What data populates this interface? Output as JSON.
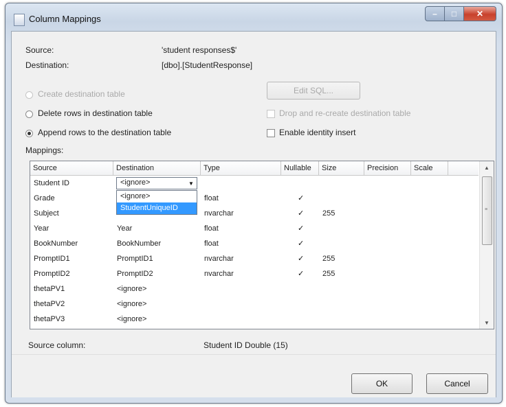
{
  "window": {
    "title": "Column Mappings"
  },
  "source": {
    "label": "Source:",
    "value": "'student responses$'"
  },
  "destination": {
    "label": "Destination:",
    "value": "[dbo].[StudentResponse]"
  },
  "options": {
    "create_table": "Create destination table",
    "delete_rows": "Delete rows in destination table",
    "append_rows": "Append rows to the destination table",
    "edit_sql": "Edit SQL...",
    "drop_recreate": "Drop and re-create destination table",
    "enable_identity": "Enable identity insert",
    "selected": "append"
  },
  "mappings": {
    "label": "Mappings:",
    "columns": [
      "Source",
      "Destination",
      "Type",
      "Nullable",
      "Size",
      "Precision",
      "Scale"
    ],
    "rows": [
      {
        "source": "Student ID",
        "destination": "<ignore>",
        "type": "",
        "nullable": false,
        "size": "",
        "precision": "",
        "scale": ""
      },
      {
        "source": "Grade",
        "destination": "",
        "type": "float",
        "nullable": true,
        "size": "",
        "precision": "",
        "scale": ""
      },
      {
        "source": "Subject",
        "destination": "",
        "type": "nvarchar",
        "nullable": true,
        "size": "255",
        "precision": "",
        "scale": ""
      },
      {
        "source": "Year",
        "destination": "Year",
        "type": "float",
        "nullable": true,
        "size": "",
        "precision": "",
        "scale": ""
      },
      {
        "source": "BookNumber",
        "destination": "BookNumber",
        "type": "float",
        "nullable": true,
        "size": "",
        "precision": "",
        "scale": ""
      },
      {
        "source": "PromptID1",
        "destination": "PromptID1",
        "type": "nvarchar",
        "nullable": true,
        "size": "255",
        "precision": "",
        "scale": ""
      },
      {
        "source": "PromptID2",
        "destination": "PromptID2",
        "type": "nvarchar",
        "nullable": true,
        "size": "255",
        "precision": "",
        "scale": ""
      },
      {
        "source": "thetaPV1",
        "destination": "<ignore>",
        "type": "",
        "nullable": false,
        "size": "",
        "precision": "",
        "scale": ""
      },
      {
        "source": "thetaPV2",
        "destination": "<ignore>",
        "type": "",
        "nullable": false,
        "size": "",
        "precision": "",
        "scale": ""
      },
      {
        "source": "thetaPV3",
        "destination": "<ignore>",
        "type": "",
        "nullable": false,
        "size": "",
        "precision": "",
        "scale": ""
      }
    ],
    "dropdown": {
      "current": "<ignore>",
      "options": [
        "<ignore>",
        "StudentUniqueID"
      ],
      "highlighted": "StudentUniqueID"
    }
  },
  "source_column": {
    "label": "Source column:",
    "value": "Student ID Double (15)"
  },
  "buttons": {
    "ok": "OK",
    "cancel": "Cancel"
  },
  "icons": {
    "title": "window-icon",
    "minimize": "minimize-icon",
    "maximize": "maximize-icon",
    "close": "close-icon",
    "check": "checkmark-icon",
    "dropdown": "chevron-down-icon"
  }
}
